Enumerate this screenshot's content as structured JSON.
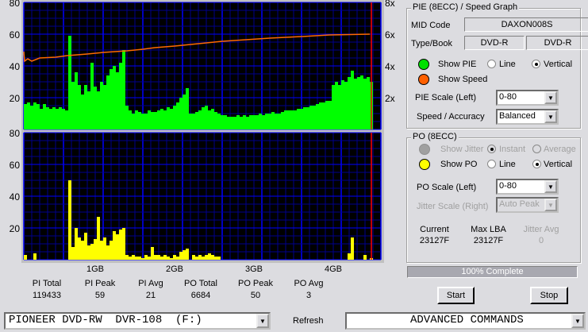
{
  "chart_data": [
    {
      "type": "bar",
      "name": "PIE (8ECC)",
      "ylim": [
        0,
        80
      ],
      "yticks": [
        20,
        40,
        60,
        80
      ],
      "y2label_ticks": [
        "2x",
        "4x",
        "6x",
        "8x"
      ],
      "y2lim": [
        0,
        8
      ],
      "x_start_gb": 0.1,
      "x_step_gb": 0.04,
      "xlim_gb": [
        0.1,
        4.6
      ],
      "end_marker_gb": 4.48,
      "values": [
        16,
        17,
        15,
        17,
        16,
        13,
        16,
        14,
        13,
        14,
        13,
        14,
        13,
        12,
        59,
        30,
        36,
        28,
        22,
        28,
        24,
        42,
        27,
        24,
        30,
        28,
        34,
        38,
        40,
        36,
        42,
        50,
        15,
        12,
        10,
        12,
        11,
        10,
        10,
        12,
        11,
        11,
        12,
        13,
        12,
        14,
        13,
        15,
        17,
        20,
        22,
        26,
        10,
        10,
        11,
        12,
        14,
        15,
        12,
        13,
        11,
        10,
        9,
        9,
        8,
        8,
        8,
        9,
        8,
        9,
        8,
        9,
        9,
        9,
        10,
        9,
        10,
        10,
        11,
        10,
        10,
        11,
        12,
        12,
        12,
        12,
        13,
        13,
        14,
        14,
        15,
        15,
        16,
        17,
        17,
        18,
        18,
        28,
        30,
        28,
        31,
        30,
        33,
        37,
        32,
        33,
        34,
        32,
        33,
        30
      ],
      "speed": [
        [
          0.1,
          4.9
        ],
        [
          0.11,
          4.3
        ],
        [
          0.15,
          4.45
        ],
        [
          0.2,
          4.3
        ],
        [
          0.3,
          4.5
        ],
        [
          0.5,
          4.55
        ],
        [
          0.65,
          4.65
        ],
        [
          0.9,
          4.75
        ],
        [
          1.1,
          4.85
        ],
        [
          1.4,
          4.95
        ],
        [
          1.6,
          5.05
        ],
        [
          1.75,
          5.15
        ],
        [
          2.0,
          5.25
        ],
        [
          2.2,
          5.35
        ],
        [
          2.4,
          5.45
        ],
        [
          2.6,
          5.55
        ],
        [
          2.9,
          5.65
        ],
        [
          3.2,
          5.75
        ],
        [
          3.6,
          5.85
        ],
        [
          3.95,
          5.95
        ],
        [
          4.46,
          6.0
        ]
      ]
    },
    {
      "type": "bar",
      "name": "PO (8ECC)",
      "ylim": [
        0,
        80
      ],
      "yticks": [
        20,
        40,
        60,
        80
      ],
      "x_start_gb": 0.1,
      "x_step_gb": 0.04,
      "values": [
        3,
        0,
        0,
        4,
        0,
        0,
        0,
        0,
        0,
        0,
        0,
        0,
        0,
        0,
        50,
        8,
        20,
        14,
        12,
        17,
        9,
        10,
        13,
        27,
        12,
        14,
        9,
        12,
        18,
        16,
        19,
        20,
        3,
        2,
        3,
        2,
        2,
        1,
        3,
        2,
        8,
        3,
        3,
        2,
        3,
        2,
        1,
        3,
        2,
        5,
        6,
        7,
        0,
        3,
        2,
        3,
        2,
        3,
        4,
        3,
        2,
        2,
        0,
        0,
        0,
        0,
        0,
        0,
        0,
        0,
        0,
        0,
        0,
        0,
        0,
        0,
        0,
        0,
        0,
        0,
        0,
        0,
        0,
        0,
        0,
        0,
        0,
        0,
        0,
        0,
        0,
        0,
        0,
        0,
        0,
        0,
        0,
        0,
        0,
        0,
        0,
        0,
        4,
        14,
        0,
        0,
        0,
        3,
        0,
        1
      ],
      "xticks": [
        "1GB",
        "2GB",
        "3GB",
        "4GB"
      ]
    }
  ],
  "colors": {
    "pie": "#00ff00",
    "po": "#ffff00",
    "speed": "#ff6a00",
    "end": "#ff0000"
  },
  "stats": [
    {
      "label": "PI Total",
      "value": "119433"
    },
    {
      "label": "PI Peak",
      "value": "59"
    },
    {
      "label": "PI Avg",
      "value": "21"
    },
    {
      "label": "PO Total",
      "value": "6684"
    },
    {
      "label": "PO Peak",
      "value": "50"
    },
    {
      "label": "PO Avg",
      "value": "3"
    }
  ],
  "pie_group": {
    "title": "PIE (8ECC) / Speed Graph",
    "mid_label": "MID Code",
    "mid_value": "DAXON008S",
    "type_label": "Type/Book",
    "type_value": "DVD-R",
    "book_value": "DVD-R",
    "show_pie": "Show PIE",
    "line": "Line",
    "vertical": "Vertical",
    "show_speed": "Show Speed",
    "scale_label": "PIE Scale (Left)",
    "scale_value": "0-80",
    "accuracy_label": "Speed / Accuracy",
    "accuracy_value": "Balanced"
  },
  "po_group": {
    "title": "PO (8ECC)",
    "show_jitter": "Show Jitter",
    "instant": "Instant",
    "average": "Average",
    "show_po": "Show PO",
    "line": "Line",
    "vertical": "Vertical",
    "scale_label": "PO Scale (Left)",
    "scale_value": "0-80",
    "jitter_scale_label": "Jitter Scale (Right)",
    "jitter_scale_value": "Auto Peak",
    "current_label": "Current",
    "current_value": "23127F",
    "maxlba_label": "Max LBA",
    "maxlba_value": "23127F",
    "jitter_avg_label": "Jitter Avg",
    "jitter_avg_value": "0"
  },
  "progress": {
    "text": "100% Complete",
    "percent": 100
  },
  "buttons": {
    "start": "Start",
    "stop": "Stop",
    "refresh": "Refresh"
  },
  "drive": "PIONEER DVD-RW  DVR-108  (F:)",
  "advanced": "ADVANCED COMMANDS",
  "arrow": "▼"
}
